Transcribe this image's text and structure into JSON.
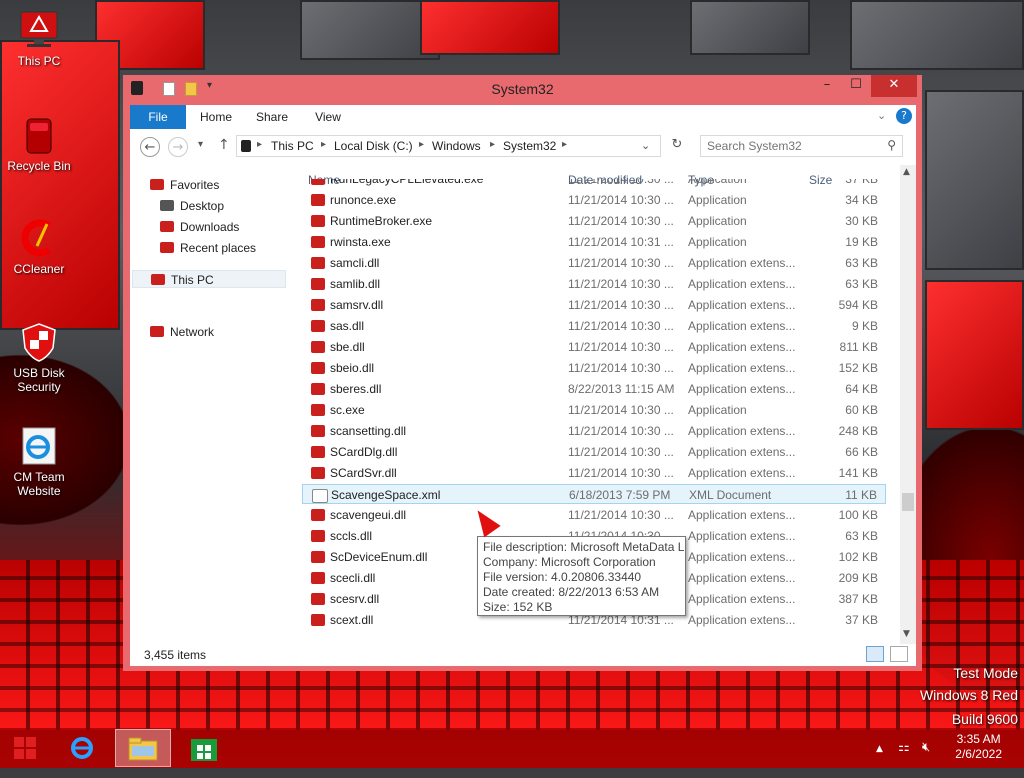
{
  "desktop": {
    "icons": [
      {
        "label": "This PC",
        "icon": "computer-icon"
      },
      {
        "label": "Recycle Bin",
        "icon": "recycle-bin-icon"
      },
      {
        "label": "CCleaner",
        "icon": "ccleaner-icon"
      },
      {
        "label": "USB Disk Security",
        "icon": "shield-icon"
      },
      {
        "label": "CM Team Website",
        "icon": "internet-explorer-icon"
      }
    ],
    "watermark": {
      "line1": "Test Mode",
      "line2": "Windows 8 Red",
      "line3": "Build 9600"
    }
  },
  "window": {
    "title": "System32",
    "controls": {
      "minimize": "–",
      "maximize": "☐",
      "close": "✕"
    },
    "ribbon_tabs": [
      "File",
      "Home",
      "Share",
      "View"
    ],
    "address": {
      "crumbs": [
        "This PC",
        "Local Disk (C:)",
        "Windows",
        "System32"
      ]
    },
    "search": {
      "placeholder": "Search System32"
    },
    "nav": {
      "favorites": "Favorites",
      "desktop": "Desktop",
      "downloads": "Downloads",
      "recent": "Recent places",
      "thispc": "This PC",
      "network": "Network"
    },
    "columns": {
      "name": "Name",
      "date": "Date modified",
      "type": "Type",
      "size": "Size"
    },
    "files": [
      {
        "name": "RunLegacyCPLElevated.exe",
        "date": "11/21/2014 10:30 ...",
        "type": "Application",
        "size": "37 KB"
      },
      {
        "name": "runonce.exe",
        "date": "11/21/2014 10:30 ...",
        "type": "Application",
        "size": "34 KB"
      },
      {
        "name": "RuntimeBroker.exe",
        "date": "11/21/2014 10:30 ...",
        "type": "Application",
        "size": "30 KB"
      },
      {
        "name": "rwinsta.exe",
        "date": "11/21/2014 10:31 ...",
        "type": "Application",
        "size": "19 KB"
      },
      {
        "name": "samcli.dll",
        "date": "11/21/2014 10:30 ...",
        "type": "Application extens...",
        "size": "63 KB"
      },
      {
        "name": "samlib.dll",
        "date": "11/21/2014 10:30 ...",
        "type": "Application extens...",
        "size": "63 KB"
      },
      {
        "name": "samsrv.dll",
        "date": "11/21/2014 10:30 ...",
        "type": "Application extens...",
        "size": "594 KB"
      },
      {
        "name": "sas.dll",
        "date": "11/21/2014 10:30 ...",
        "type": "Application extens...",
        "size": "9 KB"
      },
      {
        "name": "sbe.dll",
        "date": "11/21/2014 10:30 ...",
        "type": "Application extens...",
        "size": "811 KB"
      },
      {
        "name": "sbeio.dll",
        "date": "11/21/2014 10:30 ...",
        "type": "Application extens...",
        "size": "152 KB"
      },
      {
        "name": "sberes.dll",
        "date": "8/22/2013 11:15 AM",
        "type": "Application extens...",
        "size": "64 KB"
      },
      {
        "name": "sc.exe",
        "date": "11/21/2014 10:30 ...",
        "type": "Application",
        "size": "60 KB"
      },
      {
        "name": "scansetting.dll",
        "date": "11/21/2014 10:30 ...",
        "type": "Application extens...",
        "size": "248 KB"
      },
      {
        "name": "SCardDlg.dll",
        "date": "11/21/2014 10:30 ...",
        "type": "Application extens...",
        "size": "66 KB"
      },
      {
        "name": "SCardSvr.dll",
        "date": "11/21/2014 10:30 ...",
        "type": "Application extens...",
        "size": "141 KB"
      },
      {
        "name": "ScavengeSpace.xml",
        "date": "6/18/2013 7:59 PM",
        "type": "XML Document",
        "size": "11 KB"
      },
      {
        "name": "scavengeui.dll",
        "date": "11/21/2014 10:30 ...",
        "type": "Application extens...",
        "size": "100 KB"
      },
      {
        "name": "sccls.dll",
        "date": "11/21/2014 10:30 ...",
        "type": "Application extens...",
        "size": "63 KB"
      },
      {
        "name": "ScDeviceEnum.dll",
        "date": "11/21/2014 10:30 ...",
        "type": "Application extens...",
        "size": "102 KB"
      },
      {
        "name": "scecli.dll",
        "date": "11/21/2014 10:30 ...",
        "type": "Application extens...",
        "size": "209 KB"
      },
      {
        "name": "scesrv.dll",
        "date": "11/21/2014 10:30 ...",
        "type": "Application extens...",
        "size": "387 KB"
      },
      {
        "name": "scext.dll",
        "date": "11/21/2014 10:31 ...",
        "type": "Application extens...",
        "size": "37 KB"
      }
    ],
    "selected_index": 15,
    "status": "3,455 items",
    "tooltip": {
      "line1": "File description: Microsoft MetaData Li",
      "line2": "Company: Microsoft Corporation",
      "line3": "File version: 4.0.20806.33440",
      "line4": "Date created: 8/22/2013 6:53 AM",
      "line5": "Size: 152 KB"
    }
  },
  "taskbar": {
    "time": "3:35 AM",
    "date": "2/6/2022",
    "apps": [
      "internet-explorer-icon",
      "file-explorer-icon",
      "store-icon"
    ]
  },
  "colors": {
    "accent": "#1979ca",
    "window_frame": "#e86a6f",
    "taskbar": "#960000"
  }
}
